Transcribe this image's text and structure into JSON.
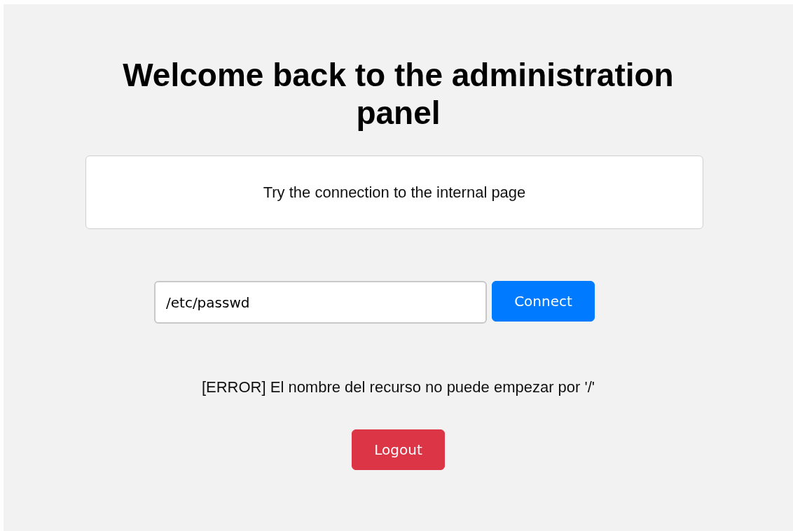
{
  "title": "Welcome back to the administration panel",
  "info_card": {
    "text": "Try the connection to the internal page"
  },
  "resource_field": {
    "value": "/etc/passwd"
  },
  "connect_button": {
    "label": "Connect"
  },
  "error_message": "[ERROR] El nombre del recurso no puede empezar por '/'",
  "logout_button": {
    "label": "Logout"
  }
}
